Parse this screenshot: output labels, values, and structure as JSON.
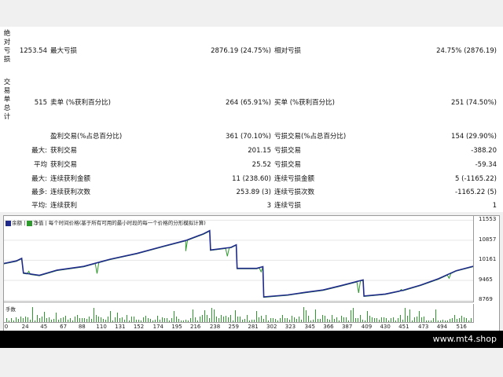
{
  "side_labels": [
    "绝对亏损",
    "交易单总计"
  ],
  "rows": [
    {
      "label": "",
      "value": "1253.54",
      "mid_label": "最大亏损",
      "mid_value": "2876.19 (24.75%)",
      "right_label": "相对亏损",
      "right_value": "24.75% (2876.19)"
    },
    {
      "label": "",
      "value": "515",
      "mid_label": "卖单 (%获利百分比)",
      "mid_value": "264 (65.91%)",
      "right_label": "买单 (%获利百分比)",
      "right_value": "251 (74.50%)"
    },
    {
      "label": "",
      "value": "",
      "mid_label": "盈利交易(%占总百分比)",
      "mid_value": "361 (70.10%)",
      "right_label": "亏损交易(%占总百分比)",
      "right_value": "154 (29.90%)"
    },
    {
      "label": "最大:",
      "value": "",
      "mid_label": "获利交易",
      "mid_value": "201.15",
      "right_label": "亏损交易",
      "right_value": "-388.20"
    },
    {
      "label": "平均",
      "value": "",
      "mid_label": "获利交易",
      "mid_value": "25.52",
      "right_label": "亏损交易",
      "right_value": "-59.34"
    },
    {
      "label": "最大:",
      "value": "",
      "mid_label": "连续获利金额",
      "mid_value": "11 (238.60)",
      "right_label": "连续亏损金额",
      "right_value": "5 (-1165.22)"
    },
    {
      "label": "最多:",
      "value": "",
      "mid_label": "连续获利次数",
      "mid_value": "253.89 (3)",
      "right_label": "连续亏损次数",
      "right_value": "-1165.22 (5)"
    },
    {
      "label": "平均:",
      "value": "",
      "mid_label": "连续获利",
      "mid_value": "3",
      "right_label": "连续亏损",
      "right_value": "1"
    }
  ],
  "chart_data": {
    "type": "line",
    "legend": [
      {
        "label": "余额",
        "color": "#1f2a8a"
      },
      {
        "label": "净值",
        "color": "#2e9a2e"
      },
      {
        "label": "每个时间价格(基于所有可用的最小时段的每一个价格的分形模拟计算)",
        "color": ""
      }
    ],
    "y_ticks": [
      11553,
      10857,
      10161,
      9465,
      8769
    ],
    "ylim": [
      8700,
      11700
    ],
    "x_ticks": [
      0,
      24,
      45,
      67,
      88,
      110,
      131,
      152,
      174,
      195,
      216,
      238,
      259,
      281,
      302,
      323,
      345,
      366,
      387,
      409,
      430,
      451,
      473,
      494,
      516
    ],
    "xlim": [
      0,
      530
    ],
    "series": [
      {
        "name": "余额",
        "color": "#1f2a8a",
        "points": [
          [
            0,
            10050
          ],
          [
            14,
            10140
          ],
          [
            20,
            10230
          ],
          [
            22,
            9720
          ],
          [
            40,
            9640
          ],
          [
            60,
            9820
          ],
          [
            90,
            9950
          ],
          [
            120,
            10200
          ],
          [
            150,
            10400
          ],
          [
            180,
            10650
          ],
          [
            205,
            10850
          ],
          [
            225,
            11080
          ],
          [
            232,
            11190
          ],
          [
            233,
            10520
          ],
          [
            256,
            10610
          ],
          [
            262,
            10700
          ],
          [
            263,
            9880
          ],
          [
            285,
            9880
          ],
          [
            292,
            9940
          ],
          [
            293,
            8890
          ],
          [
            320,
            8960
          ],
          [
            340,
            9050
          ],
          [
            360,
            9130
          ],
          [
            380,
            9280
          ],
          [
            405,
            9480
          ],
          [
            406,
            8920
          ],
          [
            430,
            8990
          ],
          [
            450,
            9120
          ],
          [
            470,
            9300
          ],
          [
            490,
            9520
          ],
          [
            510,
            9800
          ],
          [
            535,
            10000
          ]
        ]
      },
      {
        "name": "净值",
        "color": "#2e9a2e",
        "dips": [
          [
            28,
            9780
          ],
          [
            105,
            9700
          ],
          [
            205,
            10480
          ],
          [
            252,
            10300
          ],
          [
            290,
            9760
          ],
          [
            400,
            9030
          ],
          [
            448,
            9150
          ],
          [
            502,
            9540
          ]
        ]
      }
    ],
    "volume_label": "手数",
    "volume_color": "#2e9a2e"
  },
  "banner": {
    "text": "www.mt4.shop"
  }
}
